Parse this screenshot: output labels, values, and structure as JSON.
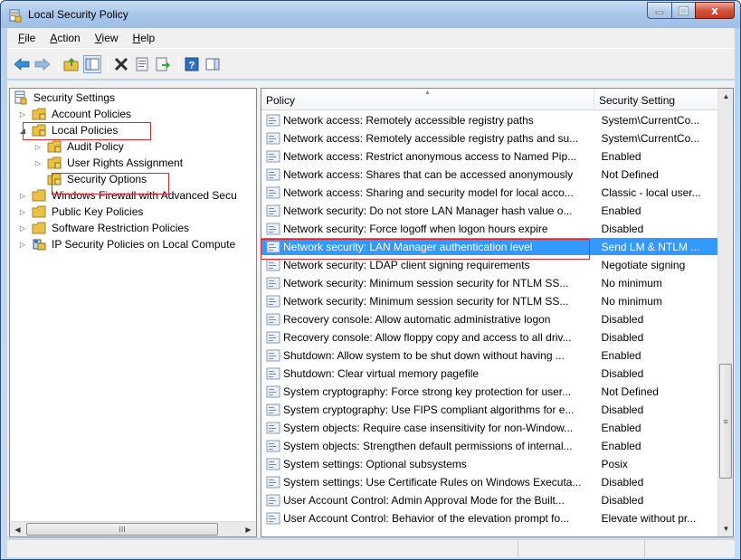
{
  "window": {
    "title": "Local Security Policy",
    "close_glyph": "x"
  },
  "menubar": {
    "items": [
      {
        "label": "File",
        "mnemonic": "F",
        "rest": "ile"
      },
      {
        "label": "Action",
        "mnemonic": "A",
        "rest": "ction"
      },
      {
        "label": "View",
        "mnemonic": "V",
        "rest": "iew"
      },
      {
        "label": "Help",
        "mnemonic": "H",
        "rest": "elp"
      }
    ]
  },
  "toolbar": {
    "icons": [
      "back-arrow-icon",
      "forward-arrow-icon",
      "up-folder-icon",
      "show-hide-tree-icon",
      "delete-icon",
      "properties-icon",
      "export-list-icon",
      "help-icon",
      "show-action-pane-icon"
    ]
  },
  "tree": {
    "root": "Security Settings",
    "items": [
      {
        "label": "Account Policies",
        "level": 1,
        "expander": "collapsed"
      },
      {
        "label": "Local Policies",
        "level": 1,
        "expander": "expanded"
      },
      {
        "label": "Audit Policy",
        "level": 2,
        "expander": "collapsed"
      },
      {
        "label": "User Rights Assignment",
        "level": 2,
        "expander": "collapsed"
      },
      {
        "label": "Security Options",
        "level": 2,
        "expander": "none"
      },
      {
        "label": "Windows Firewall with Advanced Secu",
        "level": 1,
        "expander": "collapsed"
      },
      {
        "label": "Public Key Policies",
        "level": 1,
        "expander": "collapsed"
      },
      {
        "label": "Software Restriction Policies",
        "level": 1,
        "expander": "collapsed"
      },
      {
        "label": "IP Security Policies on Local Compute",
        "level": 1,
        "expander": "collapsed"
      }
    ],
    "hscroll_grip": "III"
  },
  "list": {
    "col_policy": "Policy",
    "col_setting": "Security Setting",
    "rows": [
      {
        "policy": "Network access: Remotely accessible registry paths",
        "setting": "System\\CurrentCo..."
      },
      {
        "policy": "Network access: Remotely accessible registry paths and su...",
        "setting": "System\\CurrentCo..."
      },
      {
        "policy": "Network access: Restrict anonymous access to Named Pip...",
        "setting": "Enabled"
      },
      {
        "policy": "Network access: Shares that can be accessed anonymously",
        "setting": "Not Defined"
      },
      {
        "policy": "Network access: Sharing and security model for local acco...",
        "setting": "Classic - local user..."
      },
      {
        "policy": "Network security: Do not store LAN Manager hash value o...",
        "setting": "Enabled"
      },
      {
        "policy": "Network security: Force logoff when logon hours expire",
        "setting": "Disabled"
      },
      {
        "policy": "Network security: LAN Manager authentication level",
        "setting": "Send LM & NTLM ...",
        "selected": true
      },
      {
        "policy": "Network security: LDAP client signing requirements",
        "setting": "Negotiate signing"
      },
      {
        "policy": "Network security: Minimum session security for NTLM SS...",
        "setting": "No minimum"
      },
      {
        "policy": "Network security: Minimum session security for NTLM SS...",
        "setting": "No minimum"
      },
      {
        "policy": "Recovery console: Allow automatic administrative logon",
        "setting": "Disabled"
      },
      {
        "policy": "Recovery console: Allow floppy copy and access to all driv...",
        "setting": "Disabled"
      },
      {
        "policy": "Shutdown: Allow system to be shut down without having ...",
        "setting": "Enabled"
      },
      {
        "policy": "Shutdown: Clear virtual memory pagefile",
        "setting": "Disabled"
      },
      {
        "policy": "System cryptography: Force strong key protection for user...",
        "setting": "Not Defined"
      },
      {
        "policy": "System cryptography: Use FIPS compliant algorithms for e...",
        "setting": "Disabled"
      },
      {
        "policy": "System objects: Require case insensitivity for non-Window...",
        "setting": "Enabled"
      },
      {
        "policy": "System objects: Strengthen default permissions of internal...",
        "setting": "Enabled"
      },
      {
        "policy": "System settings: Optional subsystems",
        "setting": "Posix"
      },
      {
        "policy": "System settings: Use Certificate Rules on Windows Executa...",
        "setting": "Disabled"
      },
      {
        "policy": "User Account Control: Admin Approval Mode for the Built...",
        "setting": "Disabled"
      },
      {
        "policy": "User Account Control: Behavior of the elevation prompt fo...",
        "setting": "Elevate without pr..."
      }
    ],
    "vscroll_grip": "≡"
  },
  "colors": {
    "selection": "#3399ff",
    "highlight_annotation": "#e0262b",
    "folder": "#e8c04a"
  }
}
